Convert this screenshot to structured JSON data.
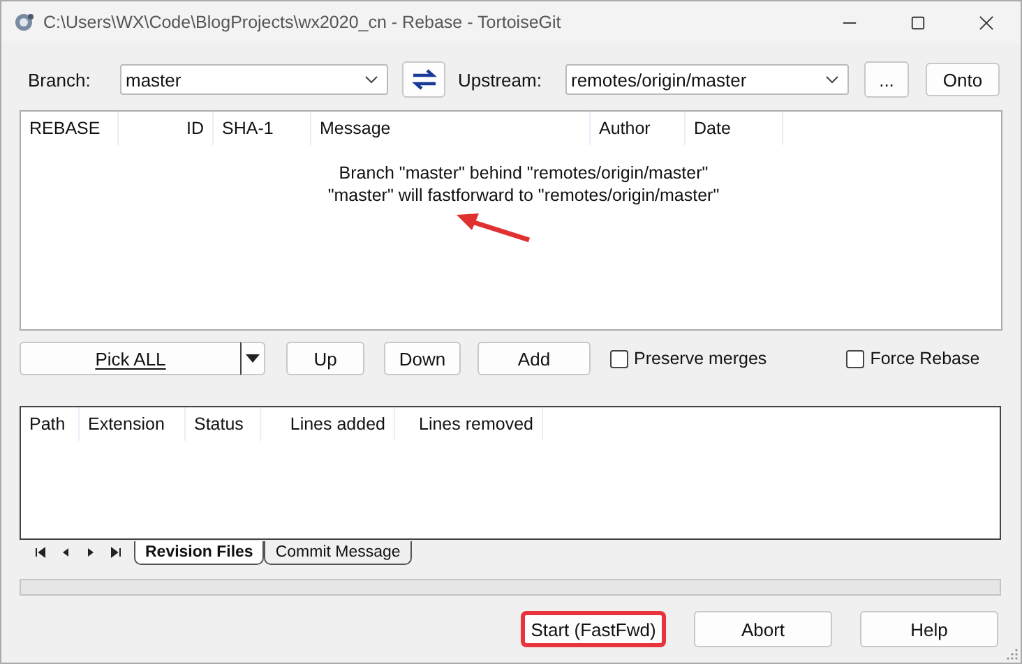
{
  "window": {
    "title": "C:\\Users\\WX\\Code\\BlogProjects\\wx2020_cn - Rebase - TortoiseGit"
  },
  "branch": {
    "label": "Branch:",
    "value": "master"
  },
  "upstream": {
    "label": "Upstream:",
    "value": "remotes/origin/master"
  },
  "top_buttons": [
    "...",
    "Onto"
  ],
  "commits": {
    "columns": [
      "REBASE",
      "ID",
      "SHA-1",
      "Message",
      "Author",
      "Date"
    ],
    "message_lines": [
      "Branch \"master\" behind \"remotes/origin/master\"",
      "\"master\" will fastforward to \"remotes/origin/master\""
    ]
  },
  "annotations": [
    {
      "kind": "arrow"
    }
  ],
  "pick_button": {
    "label": "Pick ALL"
  },
  "move_buttons": [
    "Up",
    "Down",
    "Add"
  ],
  "options": [
    {
      "label": "Preserve merges",
      "checked": false
    },
    {
      "label": "Force Rebase",
      "checked": false
    }
  ],
  "files": {
    "columns": [
      "Path",
      "Extension",
      "Status",
      "Lines added",
      "Lines removed"
    ]
  },
  "tabs": [
    {
      "label": "Revision Files",
      "selected": true
    },
    {
      "label": "Commit Message",
      "selected": false
    }
  ],
  "progress": {
    "level": 0
  },
  "bottom_buttons": [
    {
      "label": "Start (FastFwd)",
      "highlighted": true
    },
    {
      "label": "Abort",
      "highlighted": false
    },
    {
      "label": "Help",
      "highlighted": false
    }
  ]
}
